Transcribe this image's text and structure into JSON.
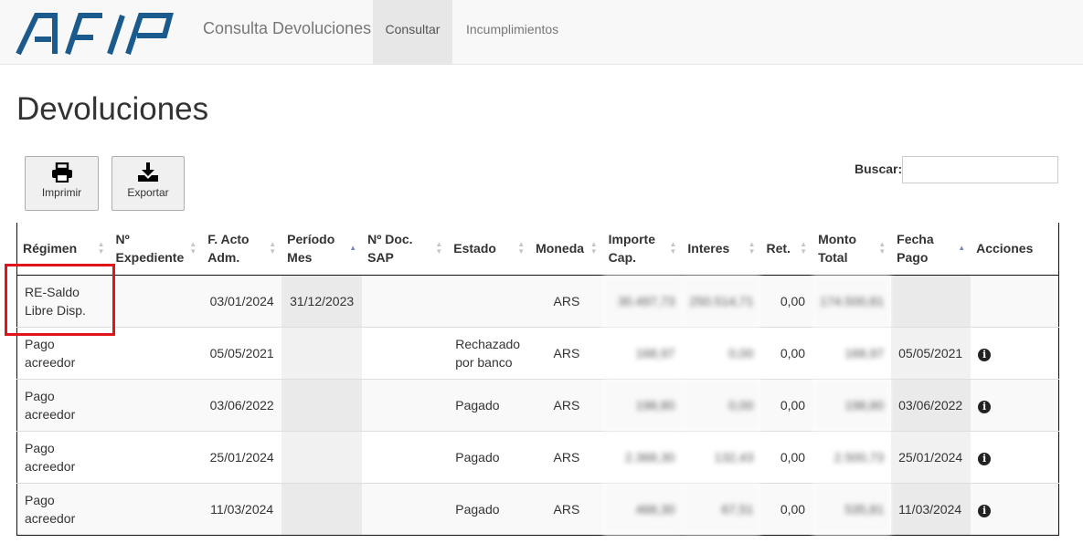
{
  "navbar": {
    "brand": "Consulta Devoluciones",
    "items": [
      {
        "label": "Consultar",
        "active": true
      },
      {
        "label": "Incumplimientos",
        "active": false
      }
    ]
  },
  "page": {
    "title": "Devoluciones"
  },
  "toolbar": {
    "print_label": "Imprimir",
    "export_label": "Exportar"
  },
  "search": {
    "label": "Buscar:",
    "value": ""
  },
  "table": {
    "columns": [
      "Régimen",
      "Nº Expediente",
      "F. Acto Adm.",
      "Período Mes",
      "Nº Doc. SAP",
      "Estado",
      "Moneda",
      "Importe Cap.",
      "Interes",
      "Ret.",
      "Monto Total",
      "Fecha Pago",
      "Acciones"
    ],
    "rows": [
      {
        "regimen": "RE-Saldo Libre Disp.",
        "expediente": "",
        "f_acto": "03/01/2024",
        "periodo": "31/12/2023",
        "doc_sap": "",
        "estado": "",
        "moneda": "ARS",
        "importe": "30.497,73",
        "interes": "250.514,71",
        "ret": "0,00",
        "monto": "174.500,81",
        "fecha_pago": "",
        "acciones": ""
      },
      {
        "regimen": "Pago acreedor",
        "expediente": "",
        "f_acto": "05/05/2021",
        "periodo": "",
        "doc_sap": "",
        "estado": "Rechazado por banco",
        "moneda": "ARS",
        "importe": "168,97",
        "interes": "0,00",
        "ret": "0,00",
        "monto": "168,97",
        "fecha_pago": "05/05/2021",
        "acciones": "i"
      },
      {
        "regimen": "Pago acreedor",
        "expediente": "",
        "f_acto": "03/06/2022",
        "periodo": "",
        "doc_sap": "",
        "estado": "Pagado",
        "moneda": "ARS",
        "importe": "198,80",
        "interes": "0,00",
        "ret": "0,00",
        "monto": "198,80",
        "fecha_pago": "03/06/2022",
        "acciones": "i"
      },
      {
        "regimen": "Pago acreedor",
        "expediente": "",
        "f_acto": "25/01/2024",
        "periodo": "",
        "doc_sap": "",
        "estado": "Pagado",
        "moneda": "ARS",
        "importe": "2.368,30",
        "interes": "132,43",
        "ret": "0,00",
        "monto": "2.500,73",
        "fecha_pago": "25/01/2024",
        "acciones": "i"
      },
      {
        "regimen": "Pago acreedor",
        "expediente": "",
        "f_acto": "11/03/2024",
        "periodo": "",
        "doc_sap": "",
        "estado": "Pagado",
        "moneda": "ARS",
        "importe": "468,30",
        "interes": "67,51",
        "ret": "0,00",
        "monto": "535,81",
        "fecha_pago": "11/03/2024",
        "acciones": "i"
      }
    ]
  },
  "colors": {
    "highlight": "#e0141b",
    "sort_active": "#7c86c6",
    "logo": "#1a5a8c"
  }
}
